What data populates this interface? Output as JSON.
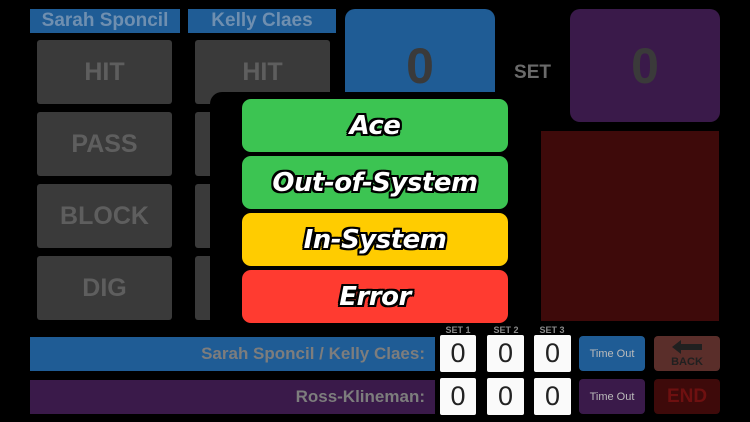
{
  "players": {
    "player1": "Sarah Sponcil",
    "player2": "Kelly Claes"
  },
  "stat_buttons": {
    "col1": [
      "HIT",
      "PASS",
      "BLOCK",
      "DIG"
    ],
    "col2": [
      "HIT"
    ]
  },
  "score": {
    "left": "0",
    "right": "0",
    "set_label": "SET"
  },
  "popup": {
    "options": [
      {
        "label": "Ace",
        "color": "#3cc452"
      },
      {
        "label": "Out-of-System",
        "color": "#3cc452"
      },
      {
        "label": "In-System",
        "color": "#ffcc00"
      },
      {
        "label": "Error",
        "color": "#ff3b30"
      }
    ]
  },
  "set_headers": [
    "SET 1",
    "SET 2",
    "SET 3"
  ],
  "teams": [
    {
      "name": "Sarah Sponcil / Kelly Claes:",
      "sets": [
        "0",
        "0",
        "0"
      ],
      "color": "#1f5c95"
    },
    {
      "name": "Ross-Klineman:",
      "sets": [
        "0",
        "0",
        "0"
      ],
      "color": "#3a1a4a"
    }
  ],
  "controls": {
    "timeout_label": "Time Out",
    "back_label": "BACK",
    "end_label": "END"
  },
  "colors": {
    "blue": "#1f5c95",
    "purple": "#3a1a4a",
    "dark_red": "#3e0a0a",
    "stat_gray": "#3a3a3a"
  }
}
